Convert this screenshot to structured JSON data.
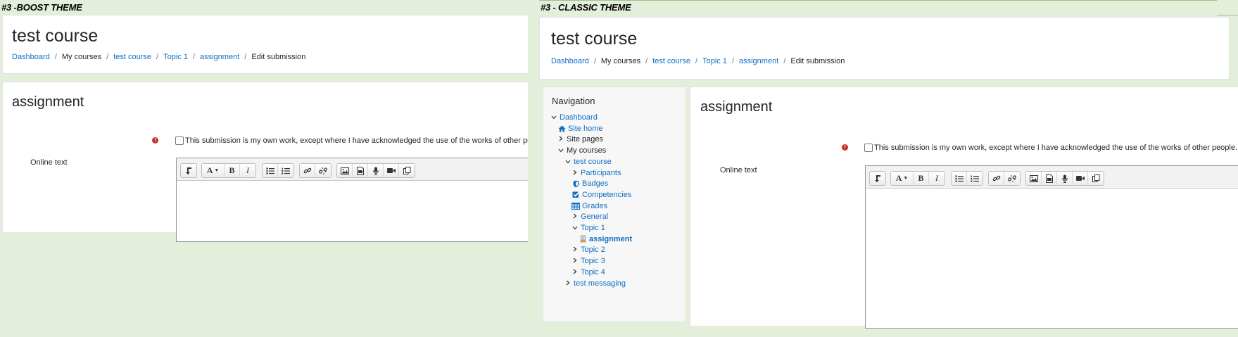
{
  "boost": {
    "label": "#3 -BOOST THEME",
    "course_title": "test course",
    "breadcrumb": [
      {
        "text": "Dashboard",
        "link": true
      },
      {
        "text": "My courses",
        "link": false
      },
      {
        "text": "test course",
        "link": true
      },
      {
        "text": "Topic 1",
        "link": true
      },
      {
        "text": "assignment",
        "link": true
      },
      {
        "text": "Edit submission",
        "link": false
      }
    ],
    "activity_title": "assignment",
    "required_mark": "!",
    "statement": "This submission is my own work, except where I have acknowledged the use of the works of other people.",
    "online_text_label": "Online text"
  },
  "classic": {
    "label": "#3 - CLASSIC THEME",
    "course_title": "test course",
    "breadcrumb": [
      {
        "text": "Dashboard",
        "link": true
      },
      {
        "text": "My courses",
        "link": false
      },
      {
        "text": "test course",
        "link": true
      },
      {
        "text": "Topic 1",
        "link": true
      },
      {
        "text": "assignment",
        "link": true
      },
      {
        "text": "Edit submission",
        "link": false
      }
    ],
    "activity_title": "assignment",
    "required_mark": "!",
    "statement": "This submission is my own work, except where I have acknowledged the use of the works of other people.",
    "online_text_label": "Online text",
    "navigation": {
      "title": "Navigation",
      "items": [
        {
          "text": "Dashboard",
          "chevron": "down",
          "icon": "",
          "style": "link"
        },
        {
          "text": "Site home",
          "chevron": "",
          "icon": "home-icon",
          "style": "link"
        },
        {
          "text": "Site pages",
          "chevron": "right",
          "icon": "",
          "style": "text"
        },
        {
          "text": "My courses",
          "chevron": "down",
          "icon": "",
          "style": "text"
        },
        {
          "text": "test course",
          "chevron": "down",
          "icon": "",
          "style": "link"
        },
        {
          "text": "Participants",
          "chevron": "right",
          "icon": "",
          "style": "link"
        },
        {
          "text": "Badges",
          "chevron": "",
          "icon": "shield-icon",
          "style": "link"
        },
        {
          "text": "Competencies",
          "chevron": "",
          "icon": "check-square-icon",
          "style": "link"
        },
        {
          "text": "Grades",
          "chevron": "",
          "icon": "table-icon",
          "style": "link"
        },
        {
          "text": "General",
          "chevron": "right",
          "icon": "",
          "style": "link"
        },
        {
          "text": "Topic 1",
          "chevron": "down",
          "icon": "",
          "style": "link"
        },
        {
          "text": "assignment",
          "chevron": "",
          "icon": "assignment-icon",
          "style": "active"
        },
        {
          "text": "Topic 2",
          "chevron": "right",
          "icon": "",
          "style": "link"
        },
        {
          "text": "Topic 3",
          "chevron": "right",
          "icon": "",
          "style": "link"
        },
        {
          "text": "Topic 4",
          "chevron": "right",
          "icon": "",
          "style": "link"
        },
        {
          "text": "test messaging",
          "chevron": "right",
          "icon": "",
          "style": "link"
        }
      ]
    }
  },
  "toolbar": {
    "groups": [
      [
        "collapse-icon"
      ],
      [
        "font-style-icon",
        "bold-icon",
        "italic-icon"
      ],
      [
        "unordered-list-icon",
        "ordered-list-icon"
      ],
      [
        "link-icon",
        "unlink-icon"
      ],
      [
        "image-icon",
        "media-icon",
        "record-audio-icon",
        "record-video-icon",
        "manage-files-icon"
      ]
    ]
  },
  "colors": {
    "background": "#e3efda",
    "link": "#0f6fc5",
    "required": "#c9302c"
  }
}
